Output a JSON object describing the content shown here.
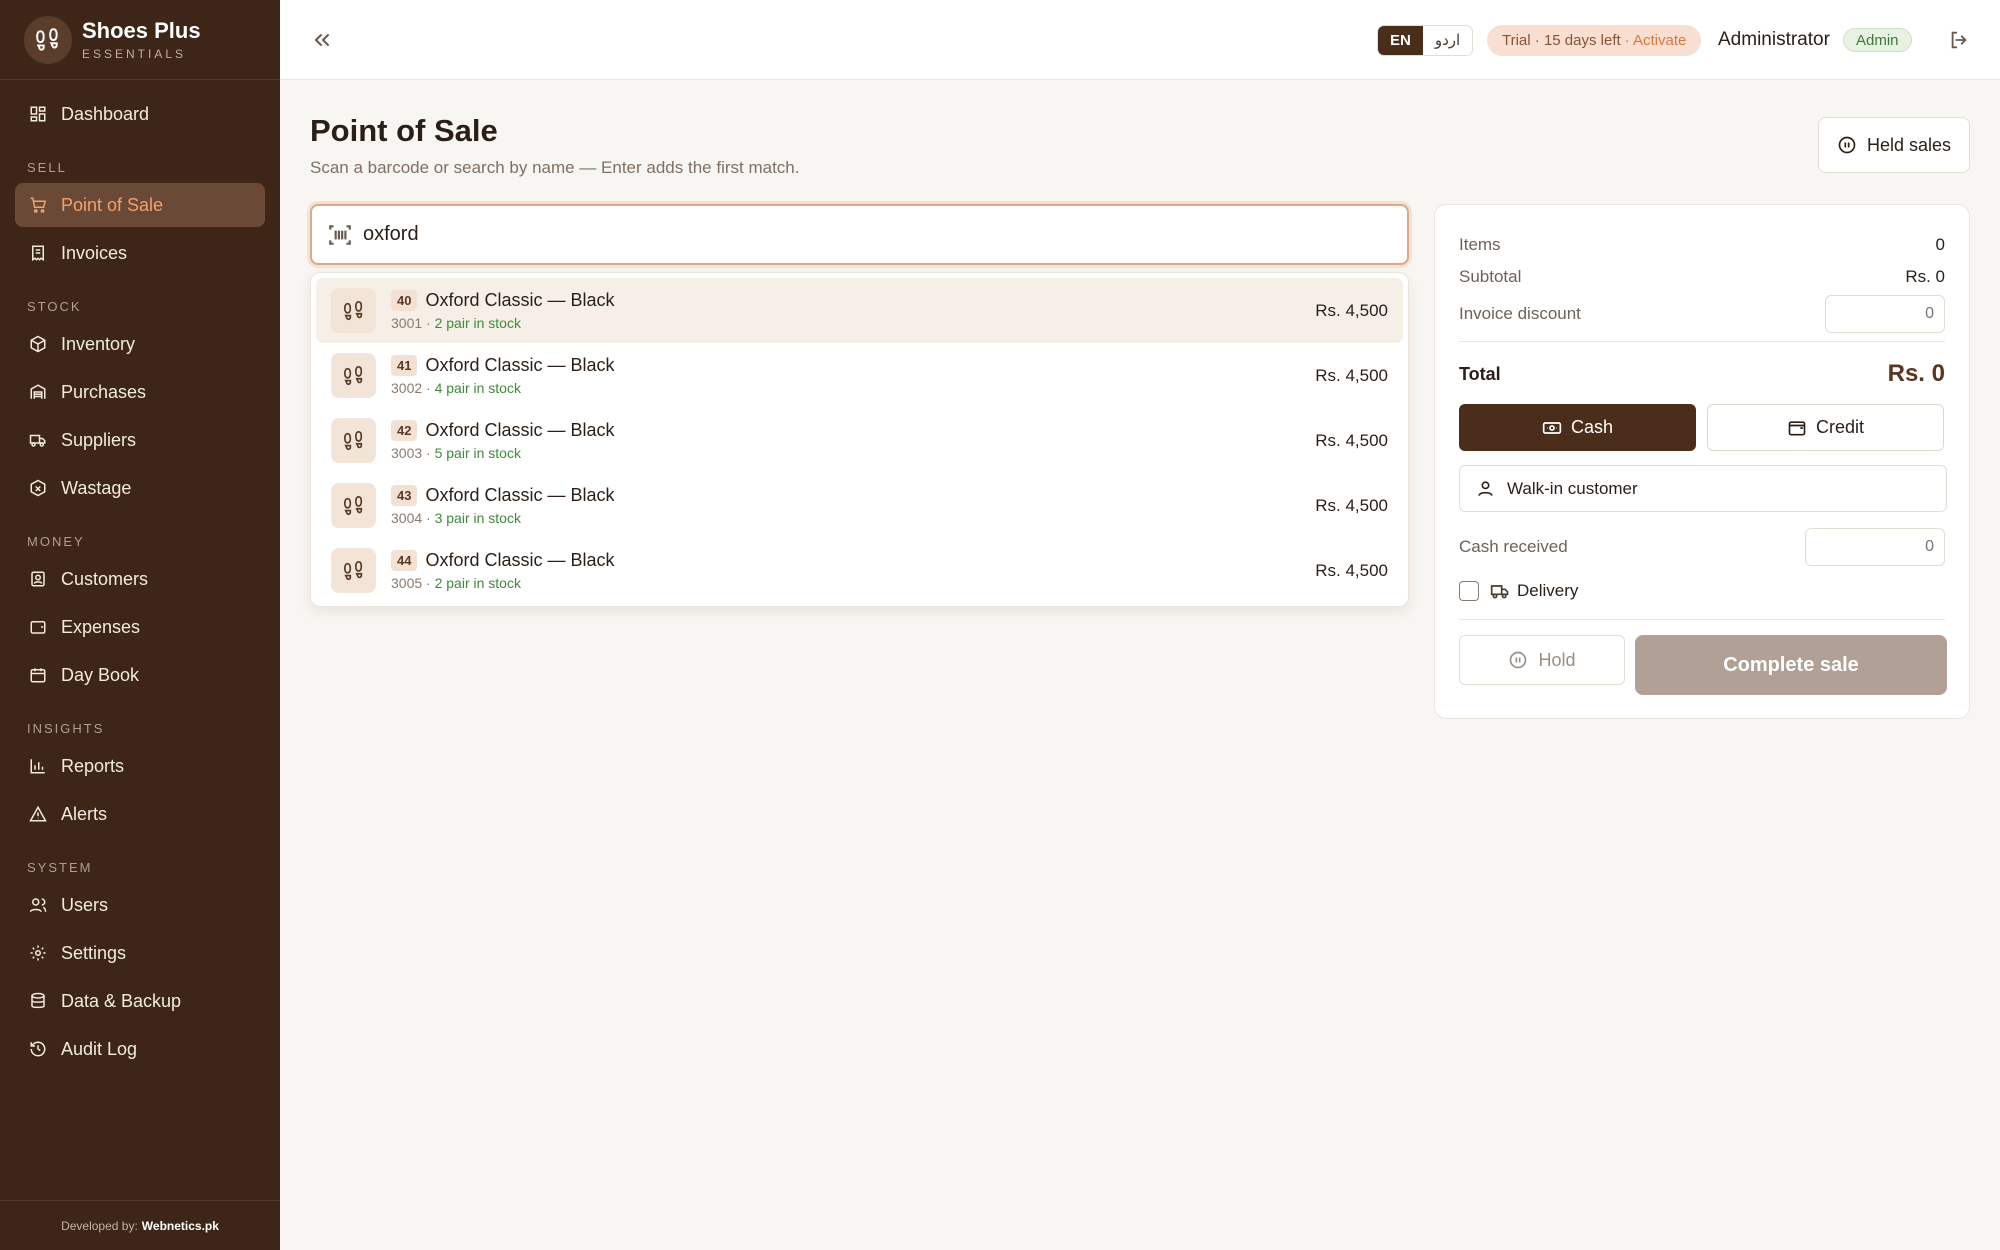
{
  "brand": {
    "name": "Shoes Plus",
    "sub": "ESSENTIALS"
  },
  "sidebar": {
    "sections": {
      "sell": "SELL",
      "stock": "STOCK",
      "money": "MONEY",
      "insights": "INSIGHTS",
      "system": "SYSTEM"
    },
    "items": {
      "dashboard": "Dashboard",
      "pos": "Point of Sale",
      "invoices": "Invoices",
      "inventory": "Inventory",
      "purchases": "Purchases",
      "suppliers": "Suppliers",
      "wastage": "Wastage",
      "customers": "Customers",
      "expenses": "Expenses",
      "daybook": "Day Book",
      "reports": "Reports",
      "alerts": "Alerts",
      "users": "Users",
      "settings": "Settings",
      "backup": "Data & Backup",
      "audit": "Audit Log"
    },
    "footer_prefix": "Developed by:",
    "footer_company": "Webnetics.pk"
  },
  "header": {
    "lang_en": "EN",
    "lang_ur": "اردو",
    "trial": "Trial · 15 days left",
    "activate": "· Activate",
    "user": "Administrator",
    "role": "Admin"
  },
  "main": {
    "title": "Point of Sale",
    "subtitle": "Scan a barcode or search by name — Enter adds the first match.",
    "held_sales": "Held sales",
    "search_value": "oxford"
  },
  "results": [
    {
      "size": "40",
      "name": "Oxford Classic — Black",
      "code": "3001 · ",
      "stock": "2 pair in stock",
      "price": "Rs. 4,500"
    },
    {
      "size": "41",
      "name": "Oxford Classic — Black",
      "code": "3002 · ",
      "stock": "4 pair in stock",
      "price": "Rs. 4,500"
    },
    {
      "size": "42",
      "name": "Oxford Classic — Black",
      "code": "3003 · ",
      "stock": "5 pair in stock",
      "price": "Rs. 4,500"
    },
    {
      "size": "43",
      "name": "Oxford Classic — Black",
      "code": "3004 · ",
      "stock": "3 pair in stock",
      "price": "Rs. 4,500"
    },
    {
      "size": "44",
      "name": "Oxford Classic — Black",
      "code": "3005 · ",
      "stock": "2 pair in stock",
      "price": "Rs. 4,500"
    }
  ],
  "cart": {
    "items_label": "Items",
    "items_value": "0",
    "subtotal_label": "Subtotal",
    "subtotal_value": "Rs. 0",
    "discount_label": "Invoice discount",
    "discount_value": "0",
    "total_label": "Total",
    "total_value": "Rs. 0",
    "cash": "Cash",
    "credit": "Credit",
    "customer": "Walk-in customer",
    "cash_received_label": "Cash received",
    "cash_received_value": "0",
    "delivery": "Delivery",
    "hold": "Hold",
    "complete": "Complete sale"
  },
  "colors": {
    "sidebar": "#3d2617",
    "accent": "#f0a26e",
    "primary": "#4a2e1b",
    "stock_green": "#3f8a3a"
  }
}
